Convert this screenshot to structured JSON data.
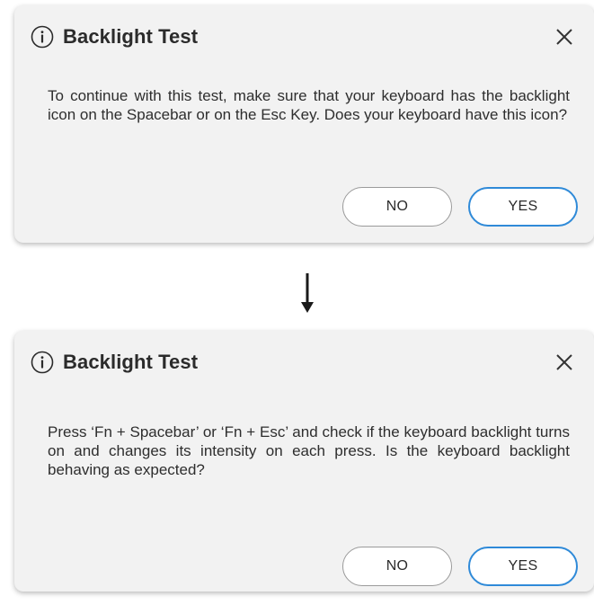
{
  "dialogs": [
    {
      "title": "Backlight Test",
      "message": "To continue with this test, make sure that your keyboard has the backlight icon on the Spacebar or on the Esc Key. Does your keyboard have this icon?",
      "no_label": "NO",
      "yes_label": "YES"
    },
    {
      "title": "Backlight Test",
      "message": "Press ‘Fn + Spacebar’ or ‘Fn + Esc’ and check if the keyboard backlight turns on and changes its intensity on each press. Is the keyboard backlight behaving as expected?",
      "no_label": "NO",
      "yes_label": "YES"
    }
  ],
  "icons": {
    "header": "info-icon",
    "close": "close-icon",
    "transition": "arrow-down-icon"
  },
  "colors": {
    "dialog_background": "#f2f2f2",
    "yes_border": "#2f8ad8",
    "no_border": "#9a9a9a"
  }
}
